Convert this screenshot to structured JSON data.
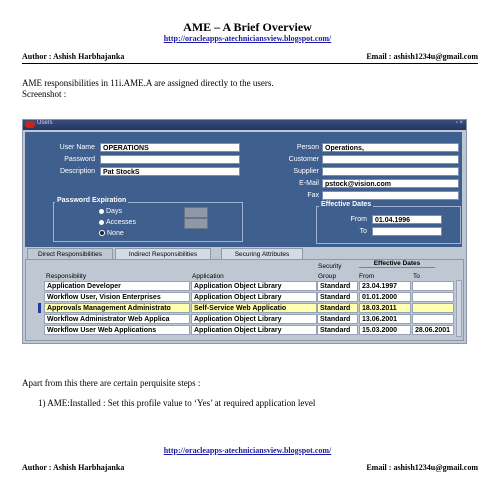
{
  "document": {
    "title": "AME – A Brief Overview",
    "header_link": "http://oracleapps-atechniciansview.blogspot.com/",
    "author": "Author : Ashish Harbhajanka",
    "email": "Email : ashish1234u@gmail.com",
    "intro_line1": "AME responsibilities in 11i.AME.A are assigned directly to the users.",
    "intro_line2": "Screenshot :",
    "after_text": "Apart from this there are certain perquisite steps :",
    "step1": "1)  AME:Installed : Set this profile value to ‘Yes’ at required application level",
    "footer_link": "http://oracleapps-atechniciansview.blogspot.com/",
    "footer_author": "Author : Ashish Harbhajanka",
    "footer_email": "Email : ashish1234u@gmail.com"
  },
  "screenshot": {
    "window_title": "Users",
    "window_controls": "▫ ×",
    "labels": {
      "user_name": "User Name",
      "password": "Password",
      "description": "Description",
      "person": "Person",
      "customer": "Customer",
      "supplier": "Supplier",
      "email": "E-Mail",
      "fax": "Fax",
      "password_expiration": "Password Expiration",
      "days": "Days",
      "accesses": "Accesses",
      "none": "None",
      "effective_dates": "Effective Dates",
      "from": "From",
      "to": "To"
    },
    "values": {
      "user_name": "OPERATIONS",
      "password": "",
      "description": "Pat StockS",
      "person": "Operations,",
      "customer": "",
      "supplier": "",
      "email": "pstock@vision.com",
      "fax": "",
      "from": "01.04.1996",
      "to": ""
    },
    "tabs": [
      "Direct Responsibilities",
      "Indirect Responsibilities",
      "Securing Attributes"
    ],
    "grid": {
      "col_responsibility": "Responsibility",
      "col_application": "Application",
      "col_security_top": "Security",
      "col_security_bottom": "Group",
      "col_effective": "Effective Dates",
      "col_from": "From",
      "col_to": "To",
      "rows": [
        {
          "responsibility": "Application Developer",
          "application": "Application Object Library",
          "security": "Standard",
          "from": "23.04.1997",
          "to": ""
        },
        {
          "responsibility": "Workflow User, Vision Enterprises",
          "application": "Application Object Library",
          "security": "Standard",
          "from": "01.01.2000",
          "to": ""
        },
        {
          "responsibility": "Approvals Management Administrato",
          "application": "Self-Service Web Applicatio",
          "security": "Standard",
          "from": "18.03.2011",
          "to": ""
        },
        {
          "responsibility": "Workflow Administrator Web Applica",
          "application": "Application Object Library",
          "security": "Standard",
          "from": "13.06.2001",
          "to": ""
        },
        {
          "responsibility": "Workflow User Web Applications",
          "application": "Application Object Library",
          "security": "Standard",
          "from": "15.03.2000",
          "to": "28.06.2001"
        }
      ]
    }
  }
}
